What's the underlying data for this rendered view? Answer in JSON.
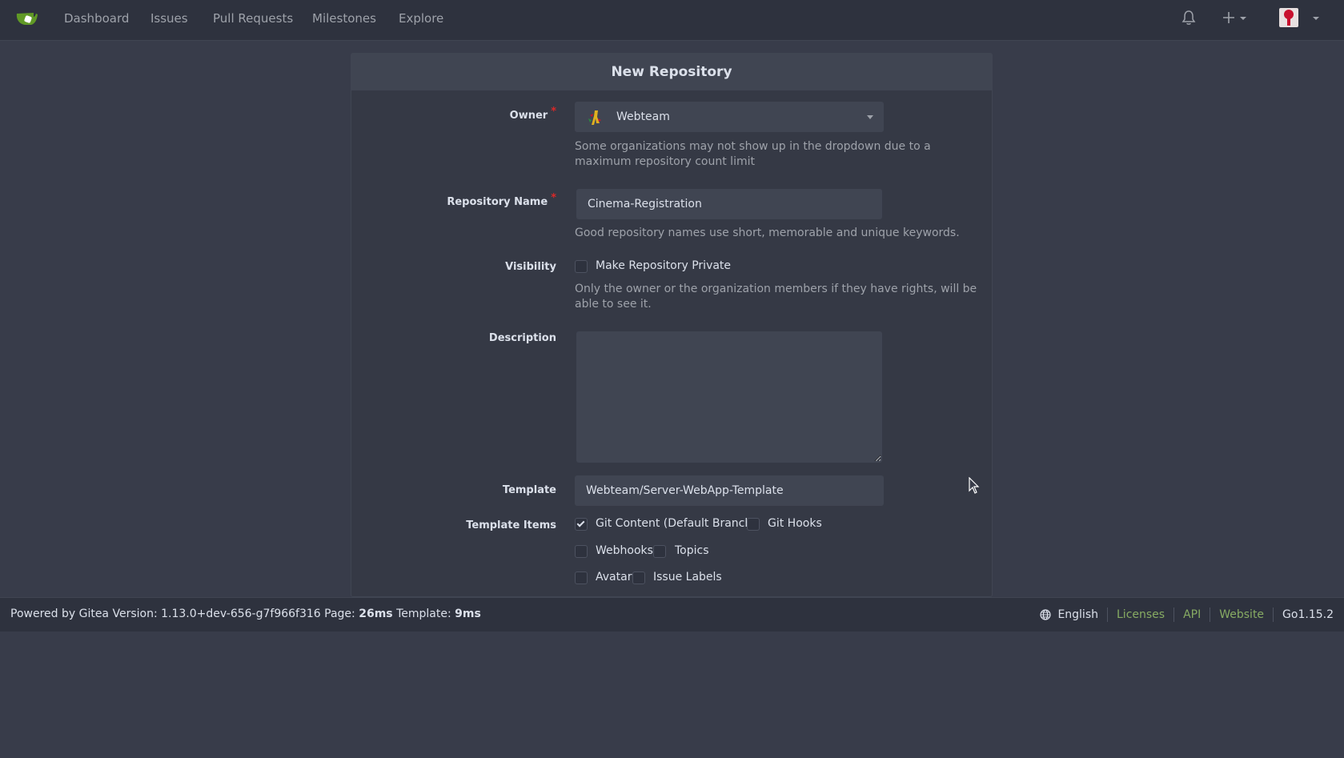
{
  "nav": {
    "items": [
      "Dashboard",
      "Issues",
      "Pull Requests",
      "Milestones",
      "Explore"
    ]
  },
  "form": {
    "title": "New Repository",
    "owner": {
      "label": "Owner",
      "value": "Webteam",
      "help": "Some organizations may not show up in the dropdown due to a maximum repository count limit"
    },
    "repo_name": {
      "label": "Repository Name",
      "value": "Cinema-Registration",
      "help": "Good repository names use short, memorable and unique keywords."
    },
    "visibility": {
      "label": "Visibility",
      "checkbox_label": "Make Repository Private",
      "checked": false,
      "help": "Only the owner or the organization members if they have rights, will be able to see it."
    },
    "description": {
      "label": "Description",
      "value": ""
    },
    "template": {
      "label": "Template",
      "value": "Webteam/Server-WebApp-Template"
    },
    "template_items": {
      "label": "Template Items",
      "items": [
        {
          "label": "Git Content (Default Branch)",
          "checked": true
        },
        {
          "label": "Git Hooks",
          "checked": false
        },
        {
          "label": "Webhooks",
          "checked": false
        },
        {
          "label": "Topics",
          "checked": false
        },
        {
          "label": "Avatar",
          "checked": false
        },
        {
          "label": "Issue Labels",
          "checked": false
        }
      ]
    }
  },
  "footer": {
    "powered_prefix": "Powered by Gitea Version: 1.13.0+dev-656-g7f966f316 Page:",
    "page_time": "26ms",
    "template_prefix": "Template:",
    "template_time": "9ms",
    "language": "English",
    "licenses": "Licenses",
    "api": "API",
    "website": "Website",
    "go_version": "Go1.15.2"
  },
  "colors": {
    "background": "#383c4a",
    "topbar": "#2e323e",
    "card": "#353945",
    "input": "#404552",
    "link": "#87ab63",
    "required": "#db2828"
  }
}
